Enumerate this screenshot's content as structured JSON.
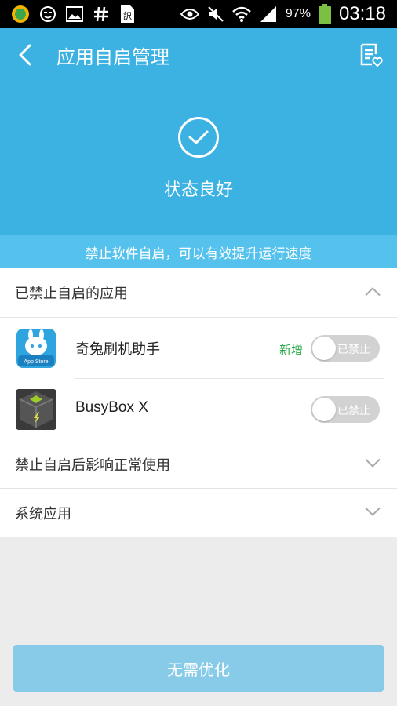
{
  "status_bar": {
    "battery_percent": "97%",
    "time": "03:18",
    "icons": [
      "app-store-icon",
      "smiley-icon",
      "image-icon",
      "hash-icon",
      "translate-icon",
      "eye-icon",
      "mute-icon",
      "wifi-icon",
      "signal-icon",
      "battery-icon"
    ]
  },
  "header": {
    "title": "应用自启管理",
    "status_text": "状态良好",
    "banner": "禁止软件自启，可以有效提升运行速度"
  },
  "sections": {
    "disabled": {
      "label": "已禁止自启的应用",
      "expanded": true
    },
    "affects": {
      "label": "禁止自启后影响正常使用",
      "expanded": false
    },
    "system": {
      "label": "系统应用",
      "expanded": false
    }
  },
  "apps": [
    {
      "name": "奇兔刷机助手",
      "tag": "新增",
      "toggle_label": "已禁止",
      "icon": "qitu-app-icon"
    },
    {
      "name": "BusyBox X",
      "tag": "",
      "toggle_label": "已禁止",
      "icon": "busybox-app-icon"
    }
  ],
  "footer": {
    "button_label": "无需优化"
  },
  "colors": {
    "primary": "#3cb2e3",
    "banner": "#55c2ed",
    "button": "#88cbe8",
    "tag_green": "#27a844"
  }
}
